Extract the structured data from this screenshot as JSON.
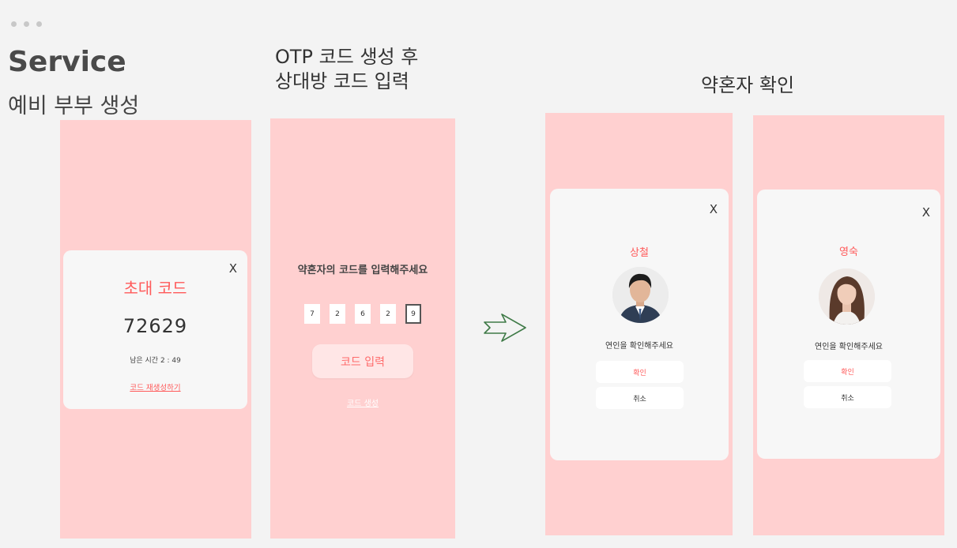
{
  "header": {
    "title": "Service",
    "subtitle": "예비 부부 생성"
  },
  "columns": {
    "otp_title_line1": "OTP 코드 생성 후",
    "otp_title_line2": "상대방 코드 입력",
    "confirm_title": "약혼자 확인"
  },
  "invite_screen": {
    "close_label": "X",
    "label": "초대 코드",
    "code": "72629",
    "remaining_time": "남은 시간 2 : 49",
    "regenerate_link": "코드 재생성하기"
  },
  "otp_screen": {
    "prompt": "약혼자의 코드를 입력해주세요",
    "digits": [
      "7",
      "2",
      "6",
      "2",
      "9"
    ],
    "submit_button": "코드 입력",
    "generate_link": "코드 생성"
  },
  "confirm_screens": [
    {
      "close_label": "X",
      "name": "상철",
      "message": "연인을 확인해주세요",
      "confirm_button": "확인",
      "cancel_button": "취소"
    },
    {
      "close_label": "X",
      "name": "영숙",
      "message": "연인을 확인해주세요",
      "confirm_button": "확인",
      "cancel_button": "취소"
    }
  ],
  "colors": {
    "background": "#f3f3f3",
    "phone": "#ffd0d0",
    "accent": "#ff5a5a",
    "card": "#f7f7f7"
  },
  "icons": {
    "flow_arrow": "arrow-right-icon",
    "window_dots": "window-dots-icon"
  }
}
